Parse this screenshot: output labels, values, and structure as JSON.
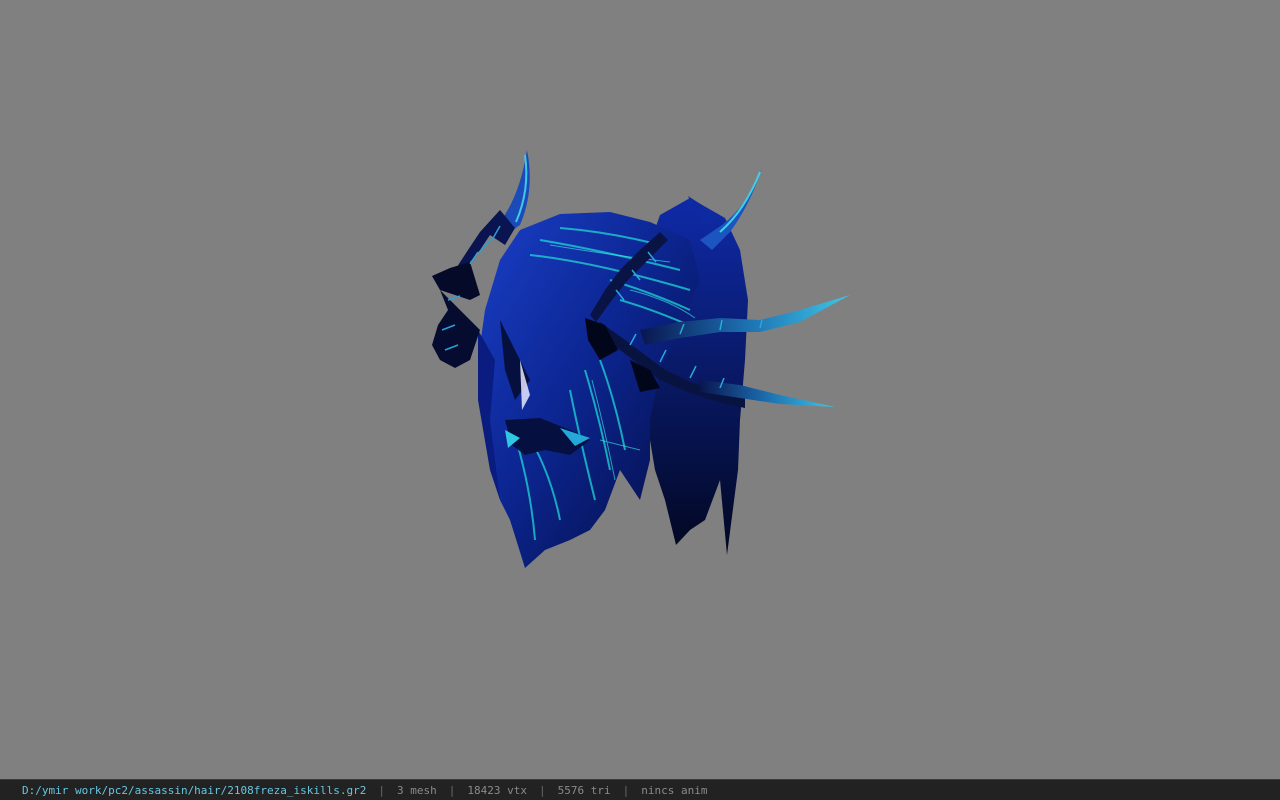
{
  "viewport": {
    "background_color": "#808080",
    "model": {
      "subject": "assassin hair mesh",
      "base_color": "#0a1a6e",
      "highlight_color": "#1fd6d6",
      "dark_color": "#02061a"
    }
  },
  "status_bar": {
    "file_path": "D:/ymir work/pc2/assassin/hair/2108freza_iskills.gr2",
    "separator": "|",
    "mesh_count": "3 mesh",
    "vertex_count": "18423 vtx",
    "triangle_count": "5576 tri",
    "anim_status": "nincs anim",
    "path_color": "#66c6e0",
    "text_color": "#8a8a8a"
  }
}
